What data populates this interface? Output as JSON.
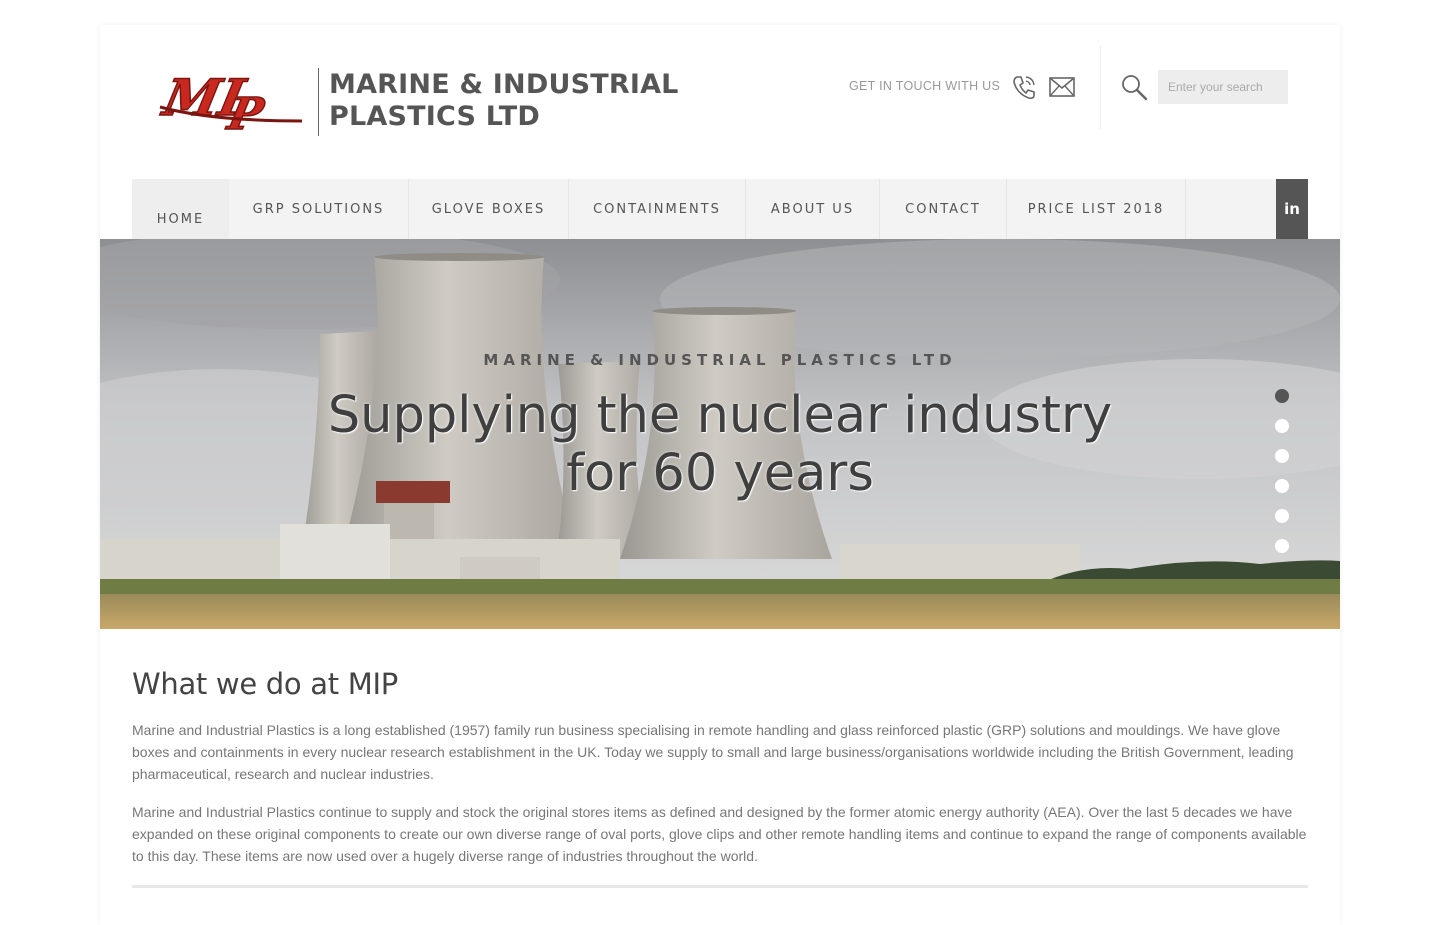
{
  "header": {
    "logo_alt": "MIP",
    "company_line1": "MARINE & INDUSTRIAL",
    "company_line2": "PLASTICS LTD",
    "contact_label": "GET IN TOUCH WITH US",
    "search_placeholder": "Enter your search",
    "icons": [
      "phone-icon",
      "mail-icon",
      "search-icon"
    ]
  },
  "nav": {
    "items": [
      {
        "label": "HOME",
        "active": true
      },
      {
        "label": "GRP SOLUTIONS"
      },
      {
        "label": "GLOVE BOXES"
      },
      {
        "label": "CONTAINMENTS"
      },
      {
        "label": "ABOUT US"
      },
      {
        "label": "CONTACT"
      },
      {
        "label": "PRICE LIST 2018"
      }
    ],
    "social_label": "in"
  },
  "hero": {
    "subtitle": "MARINE & INDUSTRIAL PLASTICS LTD",
    "title_line1": "Supplying the nuclear industry",
    "title_line2": "for 60 years",
    "slide_count": 6,
    "active_slide": 1
  },
  "content": {
    "heading": "What we do at MIP",
    "paragraph1": "Marine and Industrial Plastics is a long established (1957) family run business specialising in remote handling and glass reinforced plastic (GRP) solutions and mouldings. We have glove boxes and containments in every nuclear research establishment in the UK. Today we supply to small and large business/organisations worldwide including the British Government, leading pharmaceutical, research and nuclear industries.",
    "paragraph2": "Marine and Industrial Plastics continue to supply and stock the original stores items as defined and designed by the former atomic energy authority (AEA). Over the last 5 decades we have expanded on these original components to create our own diverse range of oval ports, glove clips and other remote handling items and continue to expand the range of components available to this day. These items are now used over a hugely diverse range of industries throughout the world."
  },
  "colors": {
    "logo_red": "#c8281e",
    "nav_bg": "#f3f3f3",
    "dark_accent": "#555555"
  }
}
